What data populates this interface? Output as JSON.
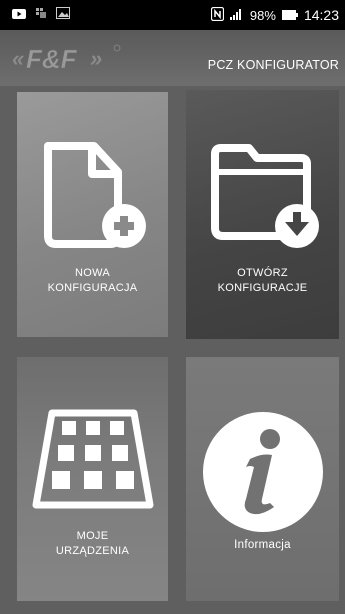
{
  "status_bar": {
    "icons": [
      "youtube-icon",
      "notification-icon",
      "gallery-icon",
      "nfc-icon",
      "signal-icon",
      "battery-icon"
    ],
    "battery": "98%",
    "time": "14:23"
  },
  "header": {
    "logo_text": "F&F",
    "title": "PCZ KONFIGURATOR"
  },
  "tiles": [
    {
      "label_line1": "NOWA",
      "label_line2": "KONFIGURACJA",
      "icon": "new-file-icon"
    },
    {
      "label_line1": "OTWÓRZ",
      "label_line2": "KONFIGURACJE",
      "icon": "open-folder-icon"
    },
    {
      "label_line1": "MOJE",
      "label_line2": "URZĄDZENIA",
      "icon": "device-grid-icon"
    },
    {
      "label_line1": "Informacja",
      "label_line2": "",
      "icon": "info-icon"
    }
  ]
}
